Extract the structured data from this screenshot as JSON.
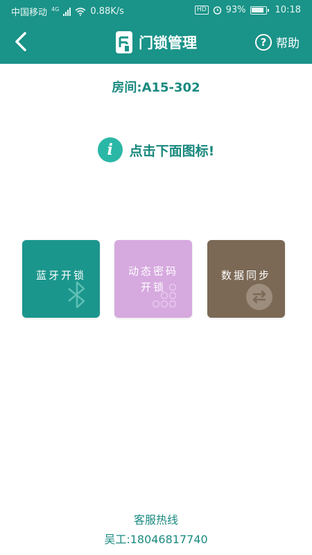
{
  "status_bar": {
    "carrier": "中国移动",
    "network": "4G",
    "speed": "0.88K/s",
    "hd": "HD",
    "battery": "93%",
    "time": "10:18"
  },
  "header": {
    "title": "门锁管理",
    "help_label": "帮助",
    "help_symbol": "?"
  },
  "room": "房间:A15-302",
  "tip": {
    "icon_letter": "i",
    "text": "点击下面图标!"
  },
  "tiles": [
    {
      "label": "蓝牙开锁",
      "icon": "bluetooth-icon",
      "color": "#1b968d"
    },
    {
      "label_line1": "动态密码",
      "label_line2": "开锁",
      "icon": "keypad-icon",
      "color": "#d6a9df"
    },
    {
      "label": "数据同步",
      "icon": "sync-icon",
      "color": "#7b6955"
    }
  ],
  "footer": {
    "hotline_label": "客服热线",
    "contact": "吴工:18046817740"
  },
  "colors": {
    "primary": "#1a9388",
    "accent_text": "#1a8a80"
  }
}
